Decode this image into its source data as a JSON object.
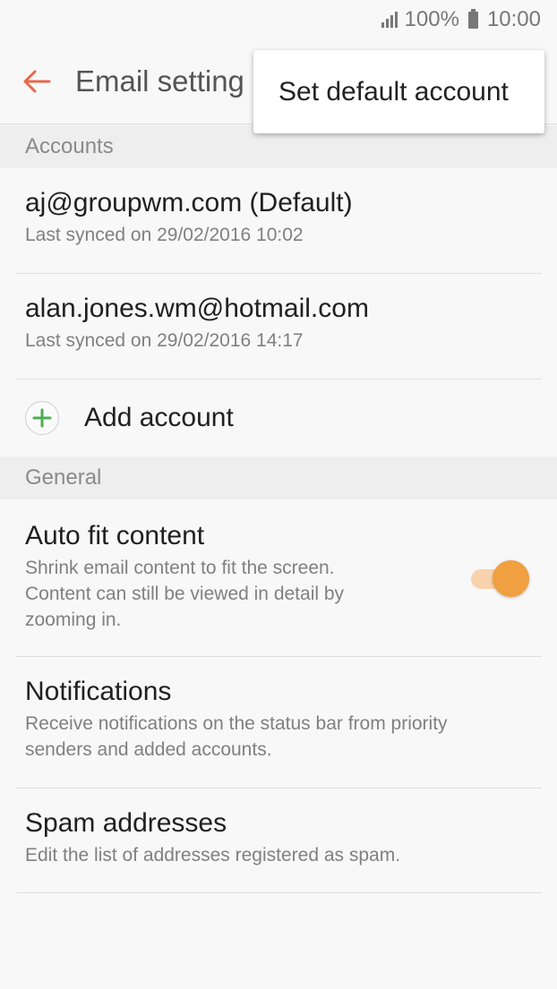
{
  "status_bar": {
    "battery": "100%",
    "time": "10:00"
  },
  "app_bar": {
    "title": "Email setting"
  },
  "popup_menu": {
    "item": "Set default account"
  },
  "accounts_section": {
    "header": "Accounts",
    "items": [
      {
        "email": "aj@groupwm.com",
        "suffix": "(Default)",
        "sync": "Last synced on 29/02/2016 10:02"
      },
      {
        "email": "alan.jones.wm@hotmail.com",
        "sync": "Last synced on 29/02/2016 14:17"
      }
    ],
    "add_label": "Add account"
  },
  "general_section": {
    "header": "General",
    "auto_fit": {
      "title": "Auto fit content",
      "desc_lines": [
        "Shrink email content to fit the screen.",
        "Content can still be viewed in detail by",
        "zooming in."
      ],
      "enabled": true
    },
    "notifications": {
      "title": "Notifications",
      "desc_lines": [
        "Receive notifications on the status bar from priority",
        "senders and added accounts."
      ]
    },
    "spam": {
      "title": "Spam addresses",
      "desc": "Edit the list of addresses registered as spam."
    }
  },
  "colors": {
    "accent": "#f0a040",
    "back_arrow": "#e8674a",
    "plus": "#4caf50"
  },
  "icons": {
    "back": "arrow-left",
    "add": "plus-circle",
    "signal": "signal-bars",
    "battery": "battery-full"
  }
}
